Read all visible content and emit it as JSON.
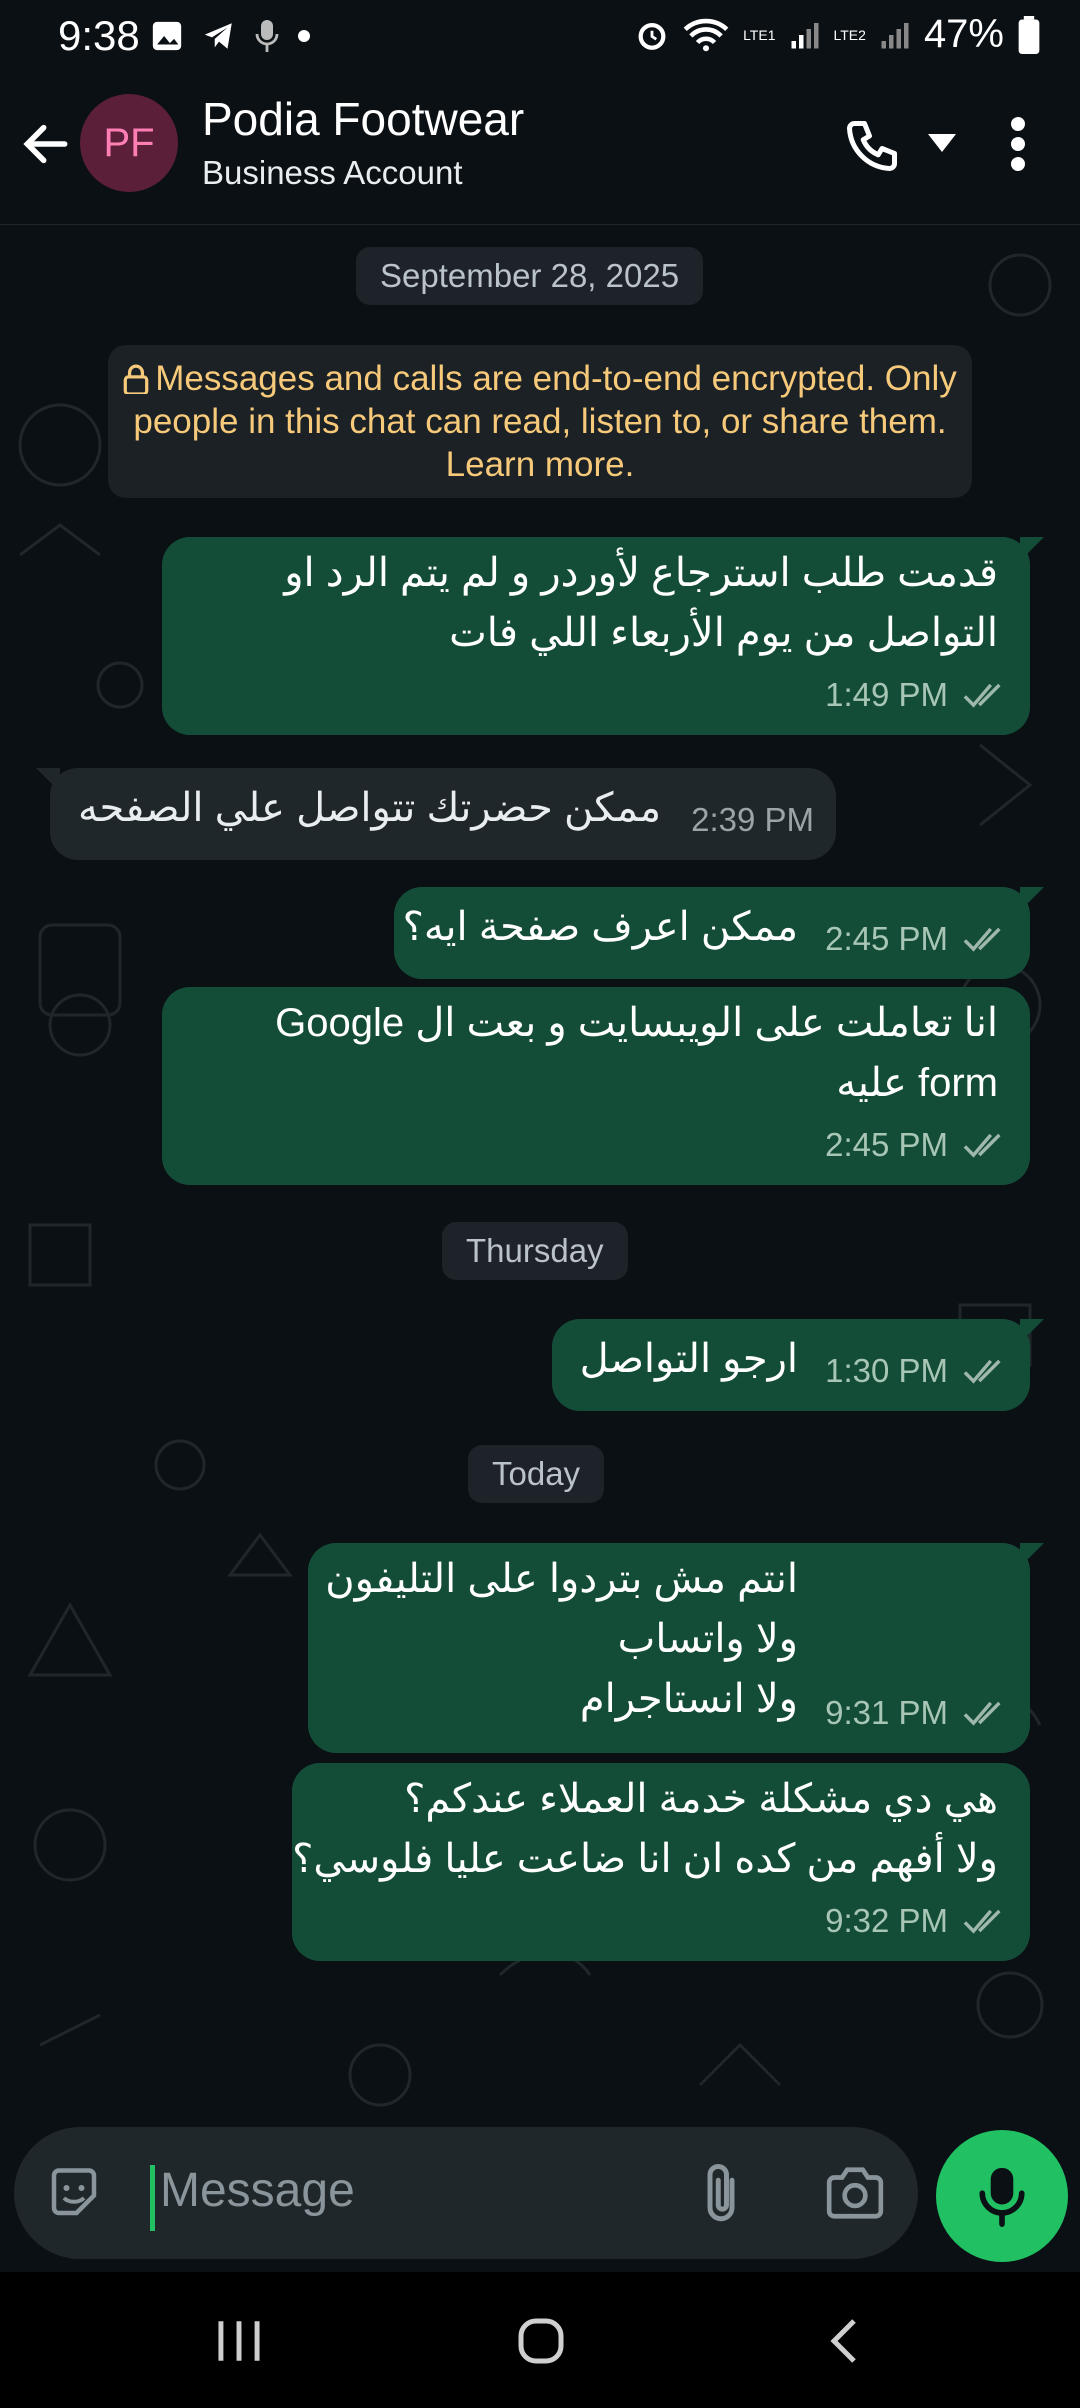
{
  "status": {
    "time": "9:38",
    "battery": "47%",
    "sim1": "LTE1",
    "sim2": "LTE2"
  },
  "header": {
    "avatar_initials": "PF",
    "title": "Podia Footwear",
    "subtitle": "Business Account"
  },
  "chat": {
    "date_1": "September 28, 2025",
    "encryption_notice": "Messages and calls are end-to-end encrypted. Only people in this chat can read, listen to, or share them. Learn more.",
    "messages": [
      {
        "lines": [
          "قدمت طلب استرجاع لأوردر و لم يتم الرد او",
          "التواصل من يوم الأربعاء اللي فات"
        ],
        "time": "1:49 PM"
      },
      {
        "text": "ممكن حضرتك تتواصل علي الصفحه",
        "time": "2:39 PM"
      },
      {
        "text": "ممكن اعرف صفحة ايه؟",
        "time": "2:45 PM"
      },
      {
        "lines": [
          "انا تعاملت على الويبسايت و بعت ال Google",
          "form عليه"
        ],
        "time": "2:45 PM"
      },
      {
        "text": "ارجو التواصل",
        "time": "1:30 PM"
      },
      {
        "lines": [
          "انتم مش بتردوا على التليفون",
          "ولا واتساب",
          "ولا انستاجرام"
        ],
        "time": "9:31 PM"
      },
      {
        "lines": [
          "هي دي مشكلة خدمة العملاء عندكم؟",
          "ولا أفهم من كده ان انا ضاعت عليا فلوسي؟"
        ],
        "time": "9:32 PM"
      }
    ],
    "date_2": "Thursday",
    "date_3": "Today"
  },
  "composer": {
    "placeholder": "Message"
  },
  "colors": {
    "accent": "#21c063",
    "outgoing_bubble": "#144d37",
    "incoming_bubble": "#1f272a",
    "background": "#0b1014"
  },
  "icons": [
    "back-arrow-icon",
    "phone-icon",
    "caret-down-icon",
    "more-vert-icon",
    "lock-icon",
    "double-check-icon",
    "sticker-icon",
    "attach-icon",
    "camera-icon",
    "mic-icon",
    "recents-icon",
    "home-icon",
    "nav-back-icon"
  ]
}
